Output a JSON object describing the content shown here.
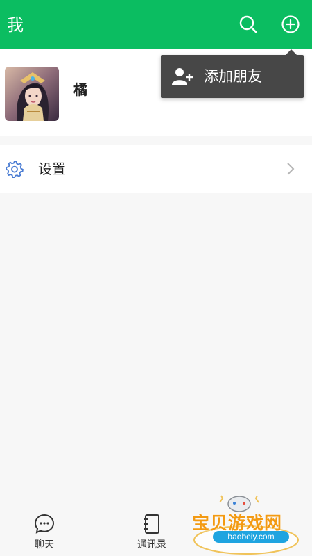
{
  "header": {
    "title": "我"
  },
  "profile": {
    "nickname": "橘"
  },
  "popup_menu": {
    "items": [
      {
        "label": "添加朋友",
        "icon": "add-friend-icon"
      }
    ]
  },
  "settings": {
    "label": "设置"
  },
  "tabbar": {
    "tabs": [
      {
        "label": "聊天",
        "icon": "chat-icon"
      },
      {
        "label": "通讯录",
        "icon": "contacts-icon"
      }
    ]
  },
  "watermark": {
    "text": "宝贝游戏网",
    "url": "baobeiy.com"
  },
  "colors": {
    "primary": "#0bbd61",
    "popup_bg": "#474747",
    "page_bg": "#f7f7f7",
    "settings_icon": "#4a7cd3"
  }
}
